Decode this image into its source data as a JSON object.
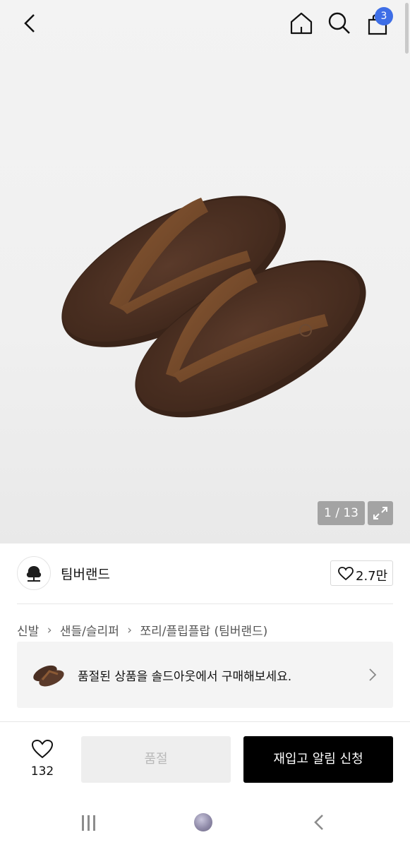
{
  "header": {
    "back_icon": "chevron-left-icon",
    "home_icon": "home-icon",
    "search_icon": "search-icon",
    "cart_icon": "shopping-bag-icon",
    "cart_count": "3",
    "badge_color": "#3e6ee6"
  },
  "gallery": {
    "counter": "1 / 13",
    "expand_icon": "expand-icon",
    "image": "brown leather flip-flop sandals"
  },
  "brand": {
    "name": "팀버랜드",
    "likes": "2.7만"
  },
  "breadcrumb": [
    "신발",
    "샌들/슬리퍼",
    "쪼리/플립플랍 (팀버랜드)"
  ],
  "soldout_banner": {
    "text": "품절된 상품을 솔드아웃에서 구매해보세요."
  },
  "bottom_bar": {
    "wish_count": "132",
    "soldout_label": "품절",
    "restock_label": "재입고 알림 신청"
  },
  "colors": {
    "accent": "#3e6ee6",
    "primary_button": "#000000",
    "disabled_button": "#eeeeee"
  }
}
